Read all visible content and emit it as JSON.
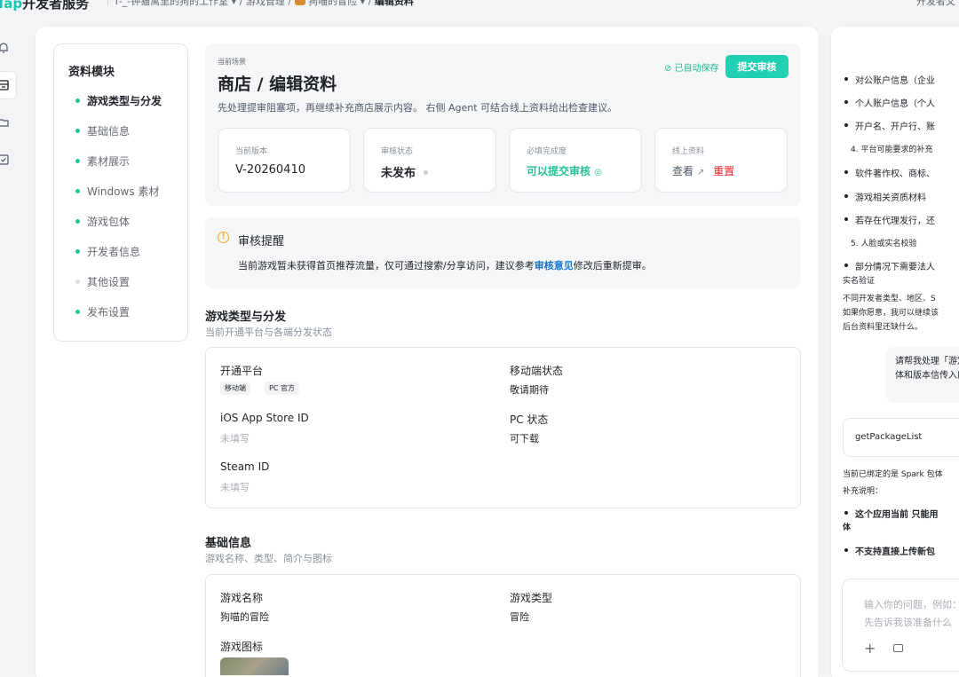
{
  "topbar": {
    "brand_a": "Tap",
    "brand_b": "开发者服务",
    "crumb_studio": "T-_-钟猫寓里的狗的工作室",
    "crumb_games": "游戏管理",
    "crumb_game": "狗喵的冒险",
    "crumb_current": "编辑资料",
    "sep": "/",
    "caret": "▾",
    "right": "开发者文"
  },
  "side": {
    "title": "资料模块",
    "items": [
      {
        "label": "游戏类型与分发"
      },
      {
        "label": "基础信息"
      },
      {
        "label": "素材展示"
      },
      {
        "label": "Windows 素材"
      },
      {
        "label": "游戏包体"
      },
      {
        "label": "开发者信息"
      },
      {
        "label": "其他设置"
      },
      {
        "label": "发布设置"
      }
    ]
  },
  "scene": {
    "tag": "当前场景",
    "title": "商店 / 编辑资料",
    "desc": "先处理提审阻塞项，再继续补充商店展示内容。 右侧 Agent 可结合线上资料给出检查建议。",
    "autosave": "已自动保存",
    "submit": "提交审核",
    "stats": [
      {
        "label": "当前版本",
        "value": "V-20260410"
      },
      {
        "label": "审核状态",
        "value": "未发布"
      },
      {
        "label": "必填完成度",
        "value": "可以提交审核"
      },
      {
        "label": "线上资料",
        "value": "查看",
        "extra": "重置"
      }
    ]
  },
  "notice": {
    "title": "审核提醒",
    "body_pre": "当前游戏暂未获得首页推荐流量，仅可通过搜索/分享访问，建议参考",
    "link": "审核意见",
    "body_post": "修改后重新提审。"
  },
  "dist": {
    "title": "游戏类型与分发",
    "sub": "当前开通平台与各端分发状态",
    "platform_label": "开通平台",
    "chips": [
      "移动端",
      "PC 官方"
    ],
    "mobile_label": "移动端状态",
    "mobile_value": "敬请期待",
    "ios_label": "iOS App Store ID",
    "ios_value": "未填写",
    "pc_label": "PC 状态",
    "pc_value": "可下载",
    "steam_label": "Steam ID",
    "steam_value": "未填写"
  },
  "basic": {
    "title": "基础信息",
    "sub": "游戏名称、类型、简介与图标",
    "name_label": "游戏名称",
    "name_value": "狗喵的冒险",
    "type_label": "游戏类型",
    "type_value": "冒险",
    "icon_label": "游戏图标"
  },
  "agent": {
    "b1": "对公账户信息（企业",
    "b2": "个人账户信息（个人",
    "b3": "开户名、开户行、账",
    "l4": "4. 平台可能要求的补充",
    "b5": "软件著作权、商标、",
    "b6": "游戏相关资质材料",
    "b7": "若存在代理发行，还",
    "l5": "5. 人脸或实名校验",
    "b8": "部分情况下需要法人",
    "l8b": "实名验证",
    "p1": "不同开发者类型、地区、S",
    "p2": "如果你愿意，我可以继续该",
    "p3": "后台资料里还缺什么。",
    "user": "请帮我处理「游定包体和版本信传入口。",
    "tool": "getPackageList",
    "r1": "当前已绑定的是 Spark 包体",
    "r2": "补充说明：",
    "r3": "这个应用当前 只能用",
    "r3b": "体",
    "r4": "不支持直接上传新包",
    "placeholder_1": "输入你的问题，例如：",
    "placeholder_2": "先告诉我该准备什么",
    "plus": "+"
  },
  "colors": {
    "accent": "#21d0b2",
    "success": "#21c19a",
    "danger": "#e5202b",
    "link": "#1677d2",
    "warn": "#f5a623"
  }
}
